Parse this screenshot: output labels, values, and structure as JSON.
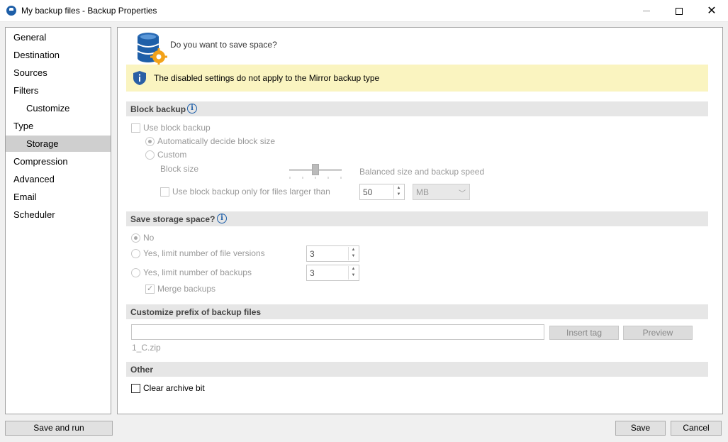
{
  "window": {
    "title": "My backup files - Backup Properties"
  },
  "nav": {
    "items": [
      {
        "label": "General",
        "selected": false,
        "sub": false
      },
      {
        "label": "Destination",
        "selected": false,
        "sub": false
      },
      {
        "label": "Sources",
        "selected": false,
        "sub": false
      },
      {
        "label": "Filters",
        "selected": false,
        "sub": false
      },
      {
        "label": "Customize",
        "selected": false,
        "sub": true
      },
      {
        "label": "Type",
        "selected": false,
        "sub": false
      },
      {
        "label": "Storage",
        "selected": true,
        "sub": true
      },
      {
        "label": "Compression",
        "selected": false,
        "sub": false
      },
      {
        "label": "Advanced",
        "selected": false,
        "sub": false
      },
      {
        "label": "Email",
        "selected": false,
        "sub": false
      },
      {
        "label": "Scheduler",
        "selected": false,
        "sub": false
      }
    ]
  },
  "header": {
    "question": "Do you want to save space?",
    "icon": "database-gear-icon"
  },
  "info": {
    "text": "The disabled settings do not apply to the Mirror backup type",
    "icon": "shield-info-icon"
  },
  "block_backup": {
    "title": "Block backup",
    "use_label": "Use block backup",
    "auto_label": "Automatically decide block size",
    "custom_label": "Custom",
    "block_size_label": "Block size",
    "speed_label": "Balanced size and backup speed",
    "slider_level": 0.5,
    "larger_label": "Use block backup only for files larger than",
    "size_value": "50",
    "unit_value": "MB"
  },
  "storage": {
    "title": "Save storage space?",
    "no_label": "No",
    "versions_label": "Yes, limit number of file versions",
    "versions_value": "3",
    "backups_label": "Yes, limit number of backups",
    "backups_value": "3",
    "merge_label": "Merge backups"
  },
  "prefix": {
    "title": "Customize prefix of backup files",
    "value": "",
    "insert_tag_label": "Insert tag",
    "preview_label": "Preview",
    "example": "1_C.zip"
  },
  "other": {
    "title": "Other",
    "clear_archive_label": "Clear archive bit"
  },
  "footer": {
    "save_run_label": "Save and run",
    "save_label": "Save",
    "cancel_label": "Cancel"
  },
  "colors": {
    "info_background": "#faf4c0",
    "accent": "#1e5fa8",
    "selected_nav": "#cfcfcf"
  }
}
